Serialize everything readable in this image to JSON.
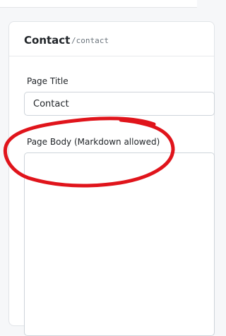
{
  "page": {
    "name": "Contact",
    "slug": "/contact"
  },
  "form": {
    "title_label": "Page Title",
    "title_value": "Contact",
    "body_label": "Page Body (Markdown allowed)",
    "body_value": ""
  },
  "annotation": {
    "color": "#e0141b"
  }
}
